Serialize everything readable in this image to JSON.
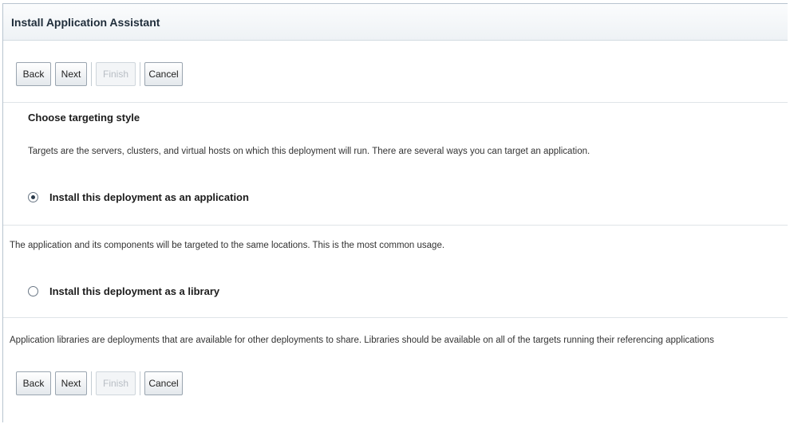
{
  "window": {
    "title": "Install Application Assistant"
  },
  "buttons": {
    "back": "Back",
    "next": "Next",
    "finish": "Finish",
    "cancel": "Cancel"
  },
  "section": {
    "heading": "Choose targeting style",
    "intro": "Targets are the servers, clusters, and virtual hosts on which this deployment will run. There are several ways you can target an application."
  },
  "options": [
    {
      "label": "Install this deployment as an application",
      "selected": true,
      "description": "The application and its components will be targeted to the same locations. This is the most common usage."
    },
    {
      "label": "Install this deployment as a library",
      "selected": false,
      "description": "Application libraries are deployments that are available for other deployments to share. Libraries should be available on all of the targets running their referencing applications"
    }
  ]
}
